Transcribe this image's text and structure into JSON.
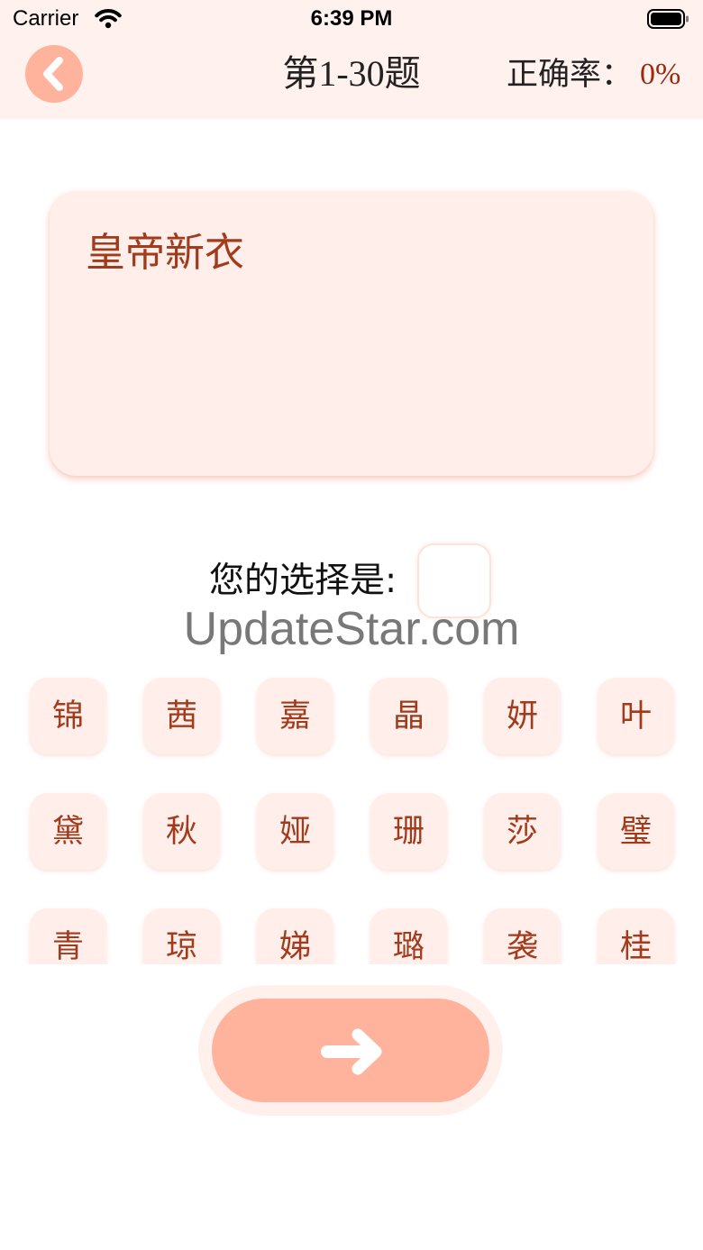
{
  "status_bar": {
    "carrier": "Carrier",
    "time": "6:39 PM",
    "wifi_icon": "wifi-icon",
    "battery_icon": "battery-icon"
  },
  "nav": {
    "back_icon": "chevron-left-icon",
    "title": "第1-30题",
    "accuracy_label": "正确率：",
    "accuracy_value": "0%"
  },
  "question": {
    "text": "皇帝新衣"
  },
  "answer": {
    "label": "您的选择是:"
  },
  "watermark": "UpdateStar.com",
  "choices": [
    [
      "锦",
      "茜",
      "嘉",
      "晶",
      "妍",
      "叶"
    ],
    [
      "黛",
      "秋",
      "娅",
      "珊",
      "莎",
      "璧"
    ],
    [
      "青",
      "琼",
      "娣",
      "璐",
      "袭",
      "桂"
    ]
  ],
  "next_button": {
    "icon": "arrow-right-icon"
  },
  "theme": {
    "bar_background": "#FFF2EE",
    "accent": "#FFB39D",
    "card_background": "#FFEEEA",
    "text_accent": "#A13B1C",
    "accuracy_value_color": "#9B2A11",
    "next_outer_background": "#FFF0EC"
  }
}
